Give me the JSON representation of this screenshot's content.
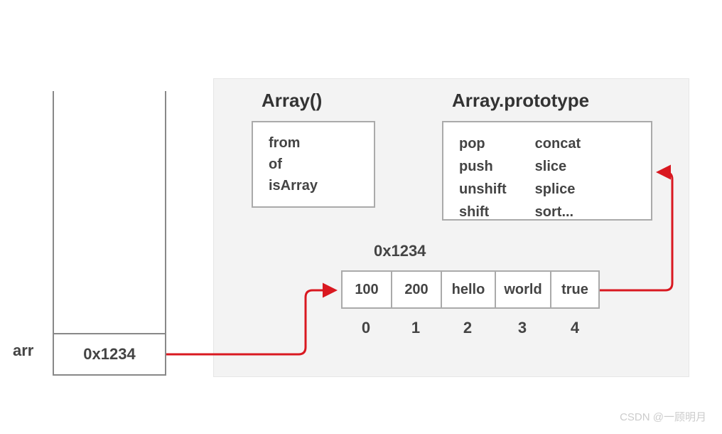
{
  "stack": {
    "var_name": "arr",
    "address": "0x1234"
  },
  "heap": {
    "array_constructor": {
      "title": "Array()",
      "methods": [
        "from",
        "of",
        "isArray"
      ]
    },
    "array_prototype": {
      "title": "Array.prototype",
      "col1": [
        "pop",
        "push",
        "unshift",
        "shift"
      ],
      "col2": [
        "concat",
        "slice",
        "splice",
        "sort..."
      ]
    },
    "instance": {
      "address": "0x1234",
      "values": [
        "100",
        "200",
        "hello",
        "world",
        "true"
      ],
      "indices": [
        "0",
        "1",
        "2",
        "3",
        "4"
      ]
    }
  },
  "watermark": "CSDN @一顾明月",
  "colors": {
    "arrow": "#d91820"
  }
}
